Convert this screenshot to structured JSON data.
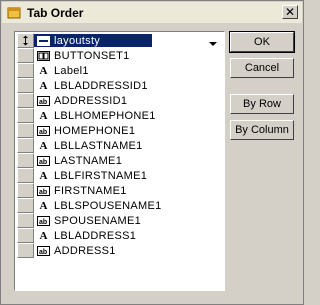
{
  "window": {
    "title": "Tab Order"
  },
  "list": {
    "items": [
      {
        "label": "layoutsty",
        "icon": "combo-icon",
        "selected": true,
        "name": "layoutsty"
      },
      {
        "label": "BUTTONSET1",
        "icon": "buttonset-icon",
        "selected": false,
        "name": "buttonset1"
      },
      {
        "label": "Label1",
        "icon": "label-icon",
        "selected": false,
        "name": "label1"
      },
      {
        "label": "LBLADDRESSID1",
        "icon": "label-icon",
        "selected": false,
        "name": "lbladdressid1"
      },
      {
        "label": "ADDRESSID1",
        "icon": "textbox-icon",
        "selected": false,
        "name": "addressid1"
      },
      {
        "label": "LBLHOMEPHONE1",
        "icon": "label-icon",
        "selected": false,
        "name": "lblhomephone1"
      },
      {
        "label": "HOMEPHONE1",
        "icon": "textbox-icon",
        "selected": false,
        "name": "homephone1"
      },
      {
        "label": "LBLLASTNAME1",
        "icon": "label-icon",
        "selected": false,
        "name": "lbllastname1"
      },
      {
        "label": "LASTNAME1",
        "icon": "textbox-icon",
        "selected": false,
        "name": "lastname1"
      },
      {
        "label": "LBLFIRSTNAME1",
        "icon": "label-icon",
        "selected": false,
        "name": "lblfirstname1"
      },
      {
        "label": "FIRSTNAME1",
        "icon": "textbox-icon",
        "selected": false,
        "name": "firstname1"
      },
      {
        "label": "LBLSPOUSENAME1",
        "icon": "label-icon",
        "selected": false,
        "name": "lblspousename1"
      },
      {
        "label": "SPOUSENAME1",
        "icon": "textbox-icon",
        "selected": false,
        "name": "spousename1"
      },
      {
        "label": "LBLADDRESS1",
        "icon": "label-icon",
        "selected": false,
        "name": "lbladdress1"
      },
      {
        "label": "ADDRESS1",
        "icon": "textbox-icon",
        "selected": false,
        "name": "address1"
      }
    ]
  },
  "buttons": {
    "ok": "OK",
    "cancel": "Cancel",
    "by_row": "By Row",
    "by_column": "By Column"
  },
  "colors": {
    "selection": "#0a246a",
    "face": "#d4d0c8"
  }
}
